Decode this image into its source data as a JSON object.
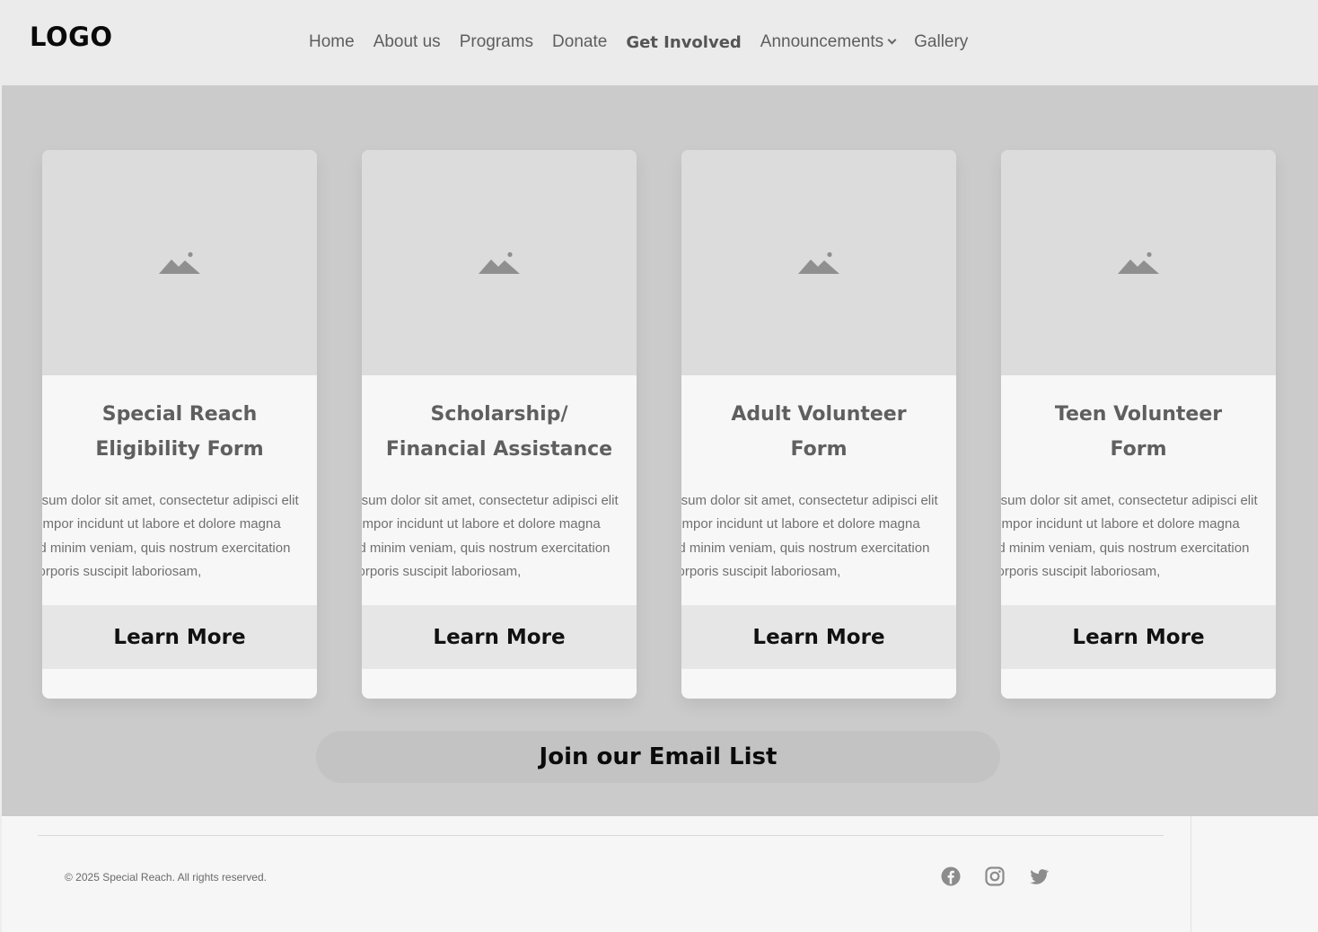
{
  "header": {
    "logo": "LOGO",
    "nav": [
      {
        "label": "Home"
      },
      {
        "label": "About us"
      },
      {
        "label": "Programs"
      },
      {
        "label": "Donate"
      },
      {
        "label": "Get Involved",
        "active": true
      },
      {
        "label": "Announcements",
        "has_dropdown": true
      },
      {
        "label": "Gallery"
      }
    ]
  },
  "cards": [
    {
      "title": "Special Reach\nEligibility Form",
      "body": "ipsum dolor sit amet, consectetur adipisci elit\ntempor incidunt ut labore et dolore magna\nad minim veniam, quis nostrum exercitation\ncorporis suscipit laboriosam,",
      "button": "Learn More",
      "image_icon": "image-placeholder-icon"
    },
    {
      "title": "Scholarship/\nFinancial Assistance",
      "body": "ipsum dolor sit amet, consectetur adipisci elit\ntempor incidunt ut labore et dolore magna\nad minim veniam, quis nostrum exercitation\ncorporis suscipit laboriosam,",
      "button": "Learn More",
      "image_icon": "image-placeholder-icon"
    },
    {
      "title": "Adult Volunteer\nForm",
      "body": "ipsum dolor sit amet, consectetur adipisci elit\ntempor incidunt ut labore et dolore magna\nad minim veniam, quis nostrum exercitation\ncorporis suscipit laboriosam,",
      "button": "Learn More",
      "image_icon": "image-placeholder-icon"
    },
    {
      "title": "Teen Volunteer\nForm",
      "body": "ipsum dolor sit amet, consectetur adipisci elit\ntempor incidunt ut labore et dolore magna\nad minim veniam, quis nostrum exercitation\ncorporis suscipit laboriosam,",
      "button": "Learn More",
      "image_icon": "image-placeholder-icon"
    }
  ],
  "email_cta": "Join our Email List",
  "footer": {
    "copyright": "© 2025 Special Reach. All rights reserved.",
    "social": [
      "facebook-icon",
      "instagram-icon",
      "twitter-icon"
    ]
  },
  "colors": {
    "header_bg": "#ebebeb",
    "section_bg": "#cbcbcb",
    "card_bg": "#f7f7f7",
    "image_bg": "#dcdcdc",
    "button_bg": "#e6e6e7",
    "icon_gray": "#8f8f8f"
  }
}
